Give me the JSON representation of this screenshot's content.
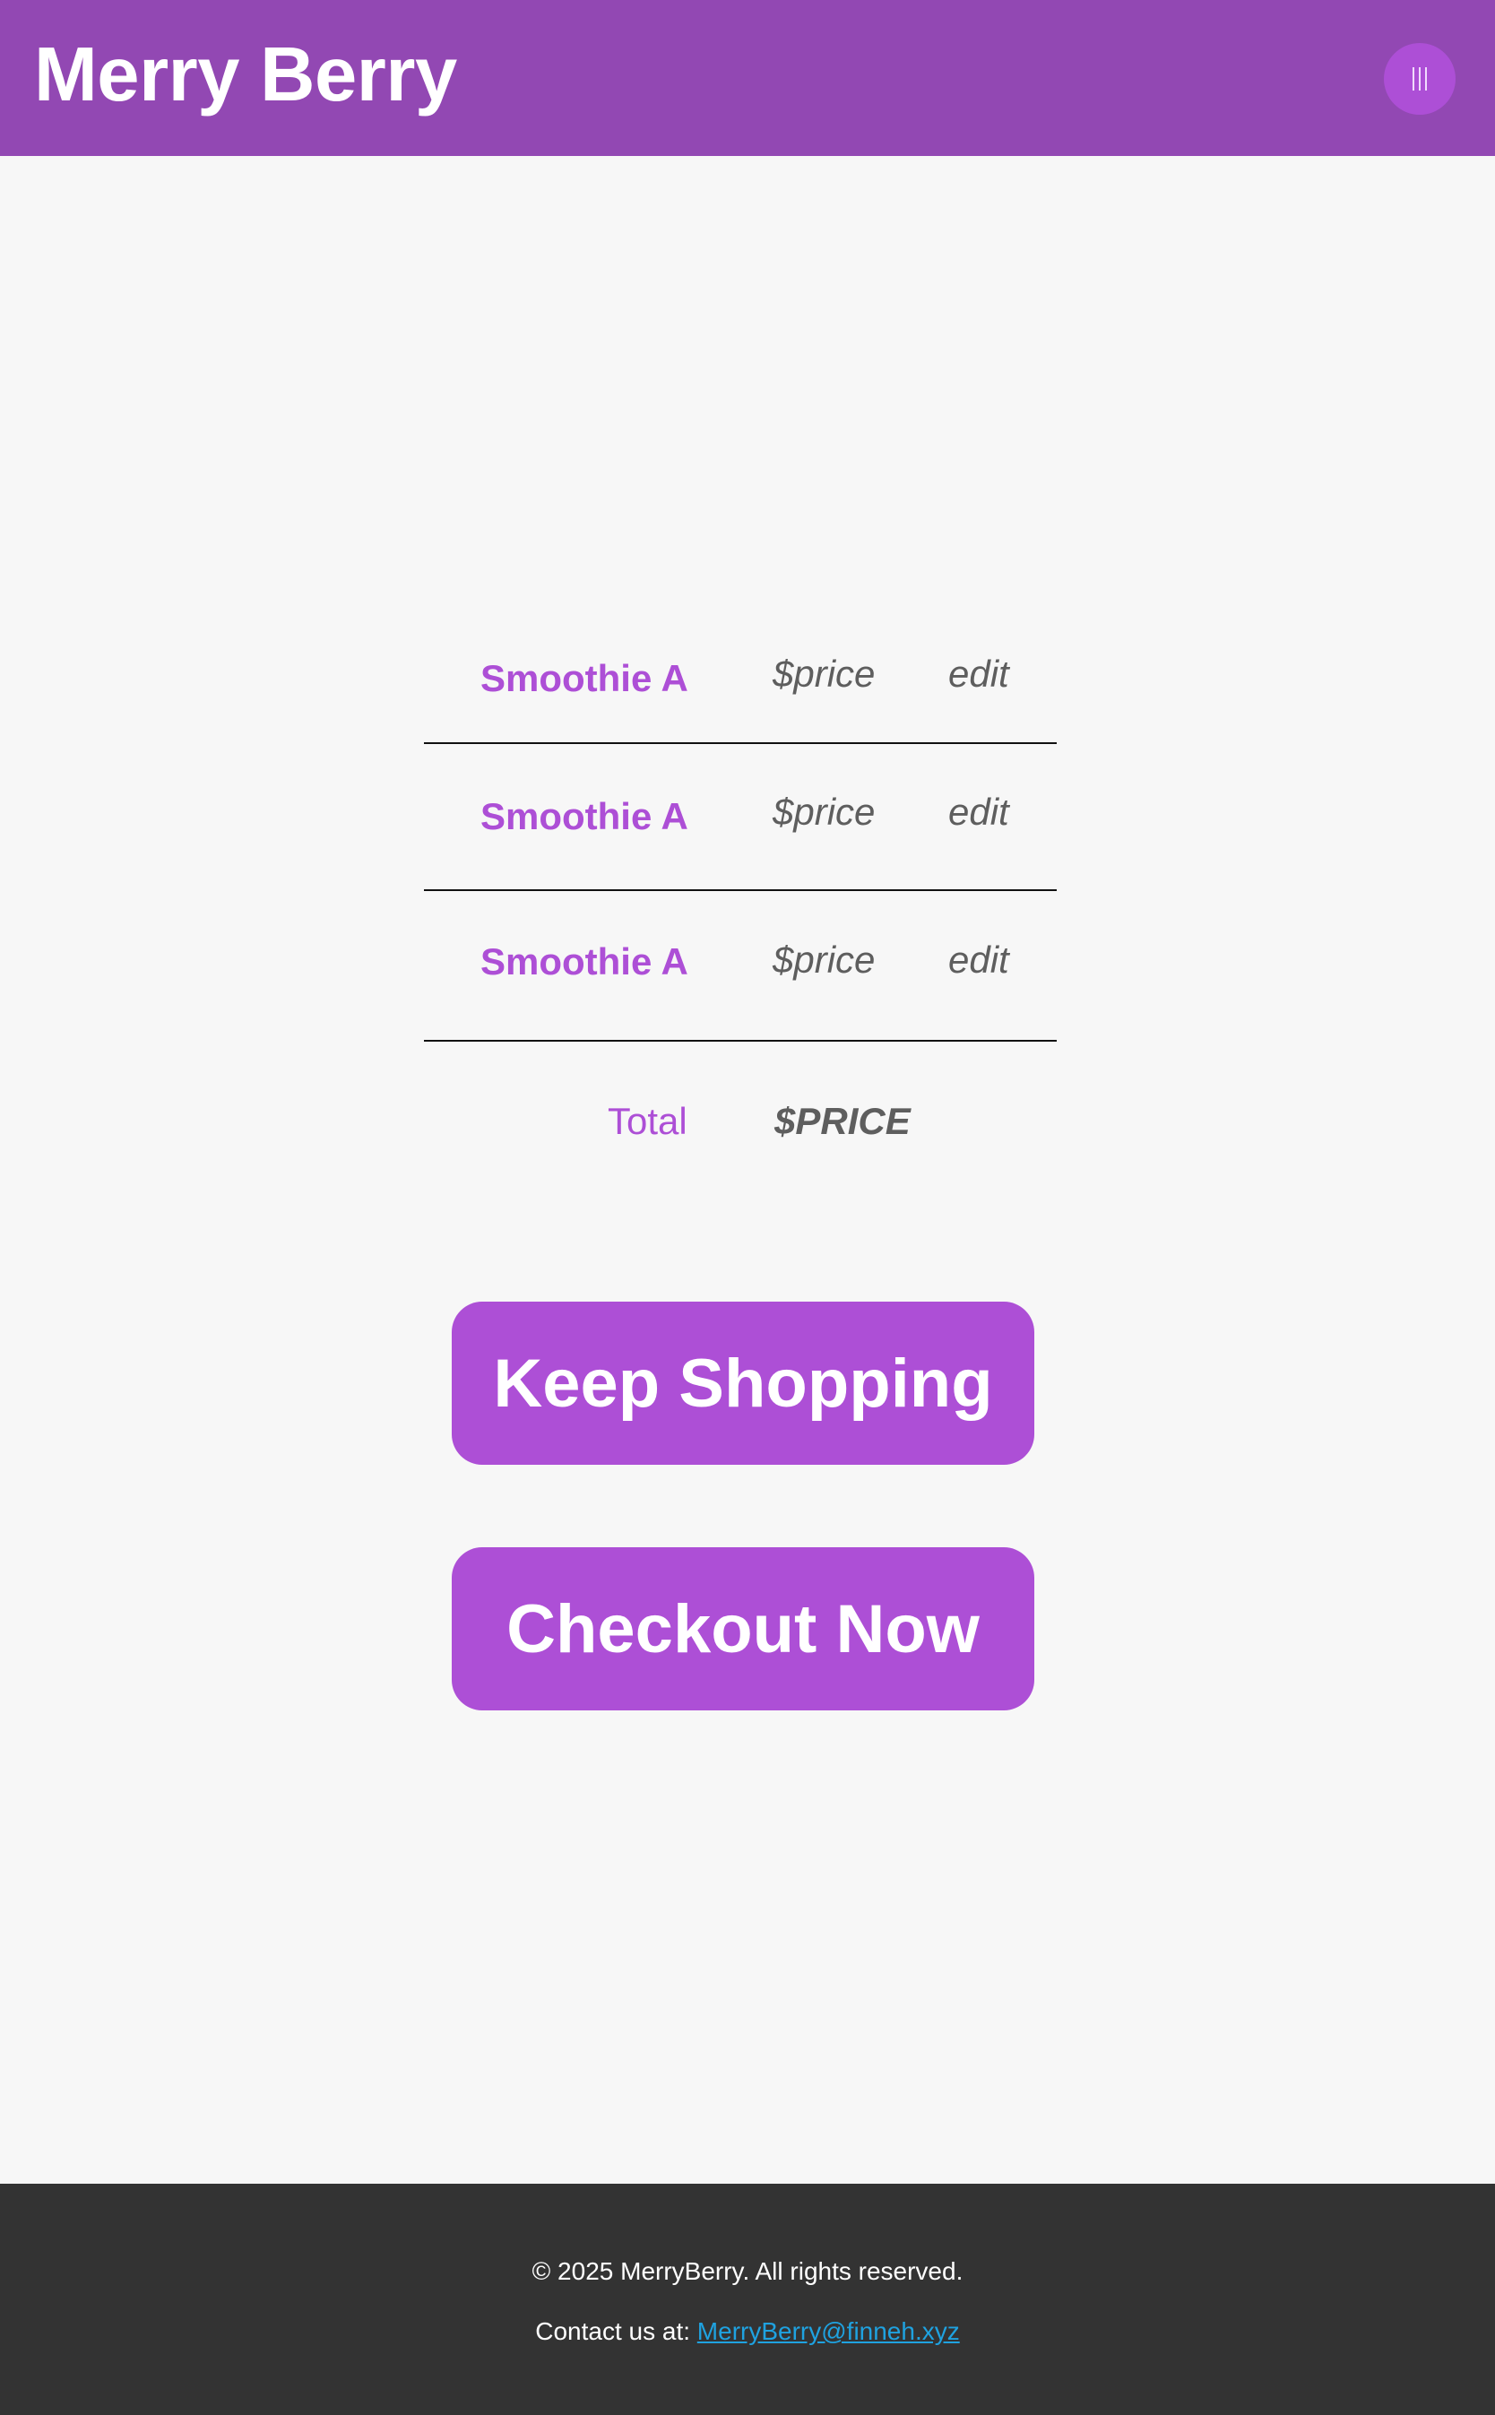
{
  "header": {
    "brand": "Merry Berry",
    "menu_icon": "menu-icon"
  },
  "cart": {
    "items": [
      {
        "name": "Smoothie A",
        "price": "$price",
        "edit_label": "edit"
      },
      {
        "name": "Smoothie A",
        "price": "$price",
        "edit_label": "edit"
      },
      {
        "name": "Smoothie A",
        "price": "$price",
        "edit_label": "edit"
      }
    ],
    "total_label": "Total",
    "total_value": "$PRICE"
  },
  "actions": {
    "keep_shopping_label": "Keep Shopping",
    "checkout_label": "Checkout Now"
  },
  "footer": {
    "copyright": "© 2025 MerryBerry. All rights reserved.",
    "contact_prefix": "Contact us at:",
    "contact_email": "MerryBerry@finneh.xyz"
  },
  "colors": {
    "header_bg": "#9248b3",
    "accent": "#ad4fd6",
    "page_bg": "#f7f7f7",
    "footer_bg": "#333333",
    "link": "#1fa2e0",
    "muted_text": "#5e5e5e"
  }
}
